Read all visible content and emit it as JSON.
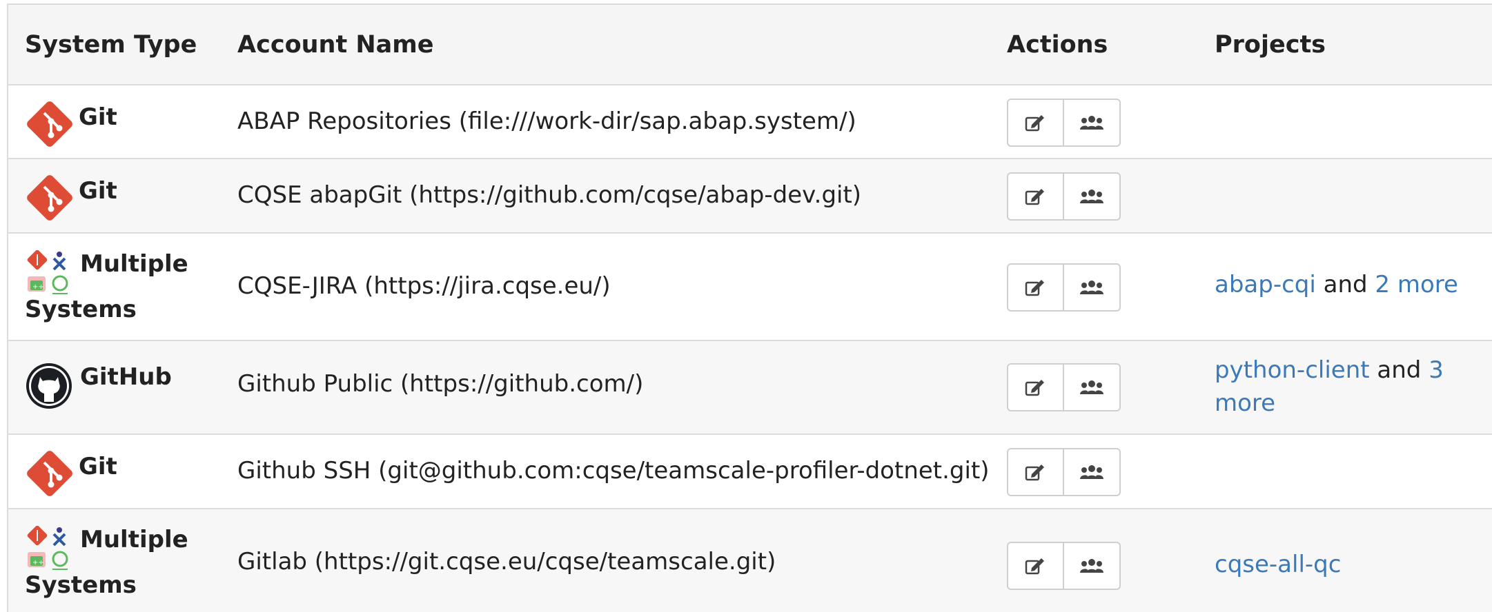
{
  "table": {
    "headers": {
      "system_type": "System Type",
      "account_name": "Account Name",
      "actions": "Actions",
      "projects": "Projects"
    },
    "rows": [
      {
        "system": "Git",
        "system_icon": "git-logo-icon",
        "account": "ABAP Repositories (file:///work-dir/sap.abap.system/)",
        "projects": []
      },
      {
        "system": "Git",
        "system_icon": "git-logo-icon",
        "account": "CQSE abapGit (https://github.com/cqse/abap-dev.git)",
        "projects": []
      },
      {
        "system_line1": "Multiple",
        "system_line2": "Systems",
        "system_icon": "multiple-systems-icon",
        "account": "CQSE-JIRA (https://jira.cqse.eu/)",
        "projects": {
          "first": "abap-cqi",
          "joiner": " and ",
          "more": "2 more"
        }
      },
      {
        "system": "GitHub",
        "system_icon": "github-logo-icon",
        "account": "Github Public (https://github.com/)",
        "projects": {
          "first": "python-client",
          "joiner": " and ",
          "more": "3 more"
        }
      },
      {
        "system": "Git",
        "system_icon": "git-logo-icon",
        "account": "Github SSH (git@github.com:cqse/teamscale-profiler-dotnet.git)",
        "projects": []
      },
      {
        "system_line1": "Multiple",
        "system_line2": "Systems",
        "system_icon": "multiple-systems-icon",
        "account": "Gitlab (https://git.cqse.eu/cqse/teamscale.git)",
        "projects": {
          "first": "cqse-all-qc"
        }
      }
    ],
    "actions": {
      "edit_icon": "edit-icon",
      "permissions_icon": "users-icon"
    }
  },
  "colors": {
    "git": "#de4c36",
    "link": "#3b79b8",
    "border": "#dcdcdc"
  }
}
